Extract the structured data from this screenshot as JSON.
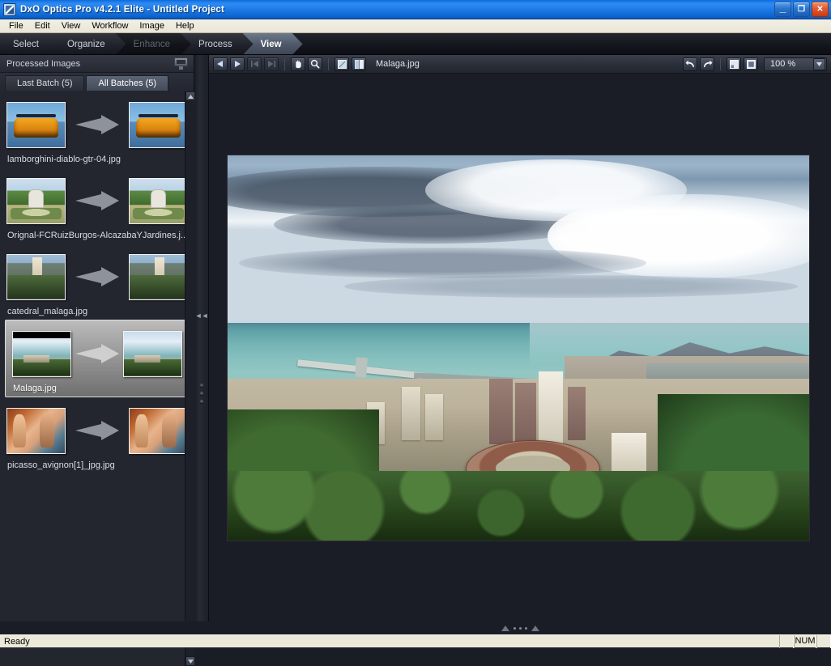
{
  "window": {
    "title": "DxO Optics Pro v4.2.1 Elite - Untitled Project",
    "app_icon": "dxo-logo-icon",
    "controls": {
      "minimize": "_",
      "restore": "❐",
      "close": "✕"
    }
  },
  "menubar": {
    "items": [
      "File",
      "Edit",
      "View",
      "Workflow",
      "Image",
      "Help"
    ]
  },
  "workflow_tabs": [
    {
      "label": "Select",
      "state": "normal"
    },
    {
      "label": "Organize",
      "state": "normal"
    },
    {
      "label": "Enhance",
      "state": "dim"
    },
    {
      "label": "Process",
      "state": "normal"
    },
    {
      "label": "View",
      "state": "active"
    }
  ],
  "left_panel": {
    "header": "Processed Images",
    "header_icon": "monitor-icon",
    "batch_tabs": [
      {
        "label": "Last Batch (5)",
        "selected": false
      },
      {
        "label": "All Batches (5)",
        "selected": true
      }
    ],
    "items": [
      {
        "caption": "lamborghini-diablo-gtr-04.jpg",
        "art": "lambo",
        "selected": false
      },
      {
        "caption": "Orignal-FCRuizBurgos-AlcazabaYJardines.j...",
        "art": "gard",
        "selected": false
      },
      {
        "caption": "catedral_malaga.jpg",
        "art": "cath",
        "selected": false
      },
      {
        "caption": "Malaga.jpg",
        "art": "mala",
        "selected": true
      },
      {
        "caption": "picasso_avignon[1]_jpg.jpg",
        "art": "pica",
        "selected": false
      }
    ]
  },
  "viewer_toolbar": {
    "buttons": [
      {
        "name": "previous-image-button",
        "icon": "triangle-left-icon",
        "disabled": false
      },
      {
        "name": "next-image-button",
        "icon": "triangle-right-icon",
        "disabled": false
      },
      {
        "name": "first-image-button",
        "icon": "skip-first-icon",
        "disabled": true
      },
      {
        "name": "last-image-button",
        "icon": "skip-last-icon",
        "disabled": true
      },
      {
        "name": "pan-tool-button",
        "icon": "hand-icon",
        "disabled": false
      },
      {
        "name": "zoom-tool-button",
        "icon": "magnifier-icon",
        "disabled": false
      },
      {
        "name": "single-view-button",
        "icon": "single-pane-icon",
        "disabled": false
      },
      {
        "name": "compare-view-button",
        "icon": "split-pane-icon",
        "disabled": false
      }
    ],
    "filename": "Malaga.jpg",
    "right_buttons": [
      {
        "name": "undo-button",
        "icon": "undo-arrow-icon"
      },
      {
        "name": "redo-button",
        "icon": "redo-arrow-icon"
      },
      {
        "name": "fit-to-window-button",
        "icon": "fit-window-icon"
      },
      {
        "name": "actual-size-button",
        "icon": "actual-size-icon"
      }
    ],
    "zoom": {
      "value": "100 %",
      "dropdown_icon": "chevron-down-icon"
    }
  },
  "splitter": {
    "collapse_icon": "collapse-left-icon",
    "grip_icon": "grip-dots-icon",
    "bottom_up_icon": "triangle-up-icon",
    "bottom_down_icon": "triangle-up-icon"
  },
  "photo": {
    "name": "Malaga.jpg",
    "alt": "Aerial panoramic view of Malaga with dramatic cloudy sky, turquoise Mediterranean sea, harbour breakwaters, the La Malagueta bullring and dense green trees in the foreground"
  },
  "statusbar": {
    "message": "Ready",
    "num_indicator": "NUM"
  }
}
